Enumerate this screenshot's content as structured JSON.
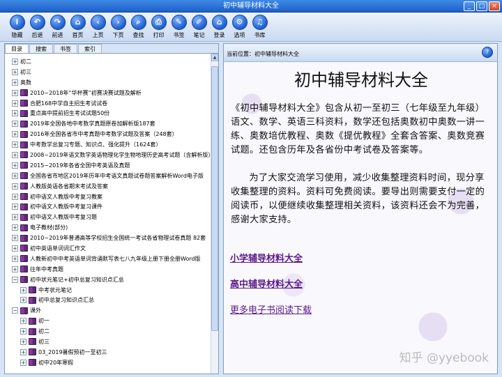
{
  "window": {
    "title": "初中辅导材料大全"
  },
  "toolbar": {
    "buttons": [
      {
        "label": "隐藏",
        "icon": "i"
      },
      {
        "label": "后退",
        "icon": "↶"
      },
      {
        "label": "前进",
        "icon": "↷"
      },
      {
        "label": "首页",
        "icon": "⌂"
      },
      {
        "label": "上页",
        "icon": "‹"
      },
      {
        "label": "下页",
        "icon": "›"
      },
      {
        "label": "查找",
        "icon": "⌕"
      },
      {
        "label": "打印",
        "icon": "⎙"
      },
      {
        "label": "书签",
        "icon": "✎"
      },
      {
        "label": "笔记",
        "icon": "✐"
      },
      {
        "label": "登录",
        "icon": "⌂"
      },
      {
        "label": "选项",
        "icon": "⚙"
      },
      {
        "label": "书库",
        "icon": "♫"
      }
    ]
  },
  "left": {
    "tabs": [
      "目录",
      "搜索",
      "书签",
      "索引"
    ],
    "tree": [
      {
        "label": "初二",
        "exp": "⊞",
        "book": false,
        "indent": 0
      },
      {
        "label": "初三",
        "exp": "⊞",
        "book": false,
        "indent": 0
      },
      {
        "label": "奥数",
        "exp": "⊞",
        "book": false,
        "indent": 0
      },
      {
        "label": "2010~2018年“华杯赛”初赛决赛试题及解析",
        "exp": "⊞",
        "book": true,
        "indent": 0
      },
      {
        "label": "合肥168中学自主招生考试试卷",
        "exp": "⊞",
        "book": true,
        "indent": 0
      },
      {
        "label": "重点高中提前招生考试试题50份",
        "exp": "⊞",
        "book": true,
        "indent": 0
      },
      {
        "label": "2019年全国各地中考数学真题原卷加解析版187套",
        "exp": "⊞",
        "book": true,
        "indent": 0
      },
      {
        "label": "2016年全国各省市中考真题中考数学试题及答案（248套）",
        "exp": "⊞",
        "book": true,
        "indent": 0
      },
      {
        "label": "中考数学总复习专题、知识点、强化提升（1624套）",
        "exp": "⊞",
        "book": true,
        "indent": 0
      },
      {
        "label": "2008~2019年语文数学英语物理化学生物地理历史高考试题（含解析版）",
        "exp": "⊞",
        "book": true,
        "indent": 0
      },
      {
        "label": "2015~2019年各省全国中考英语及真题",
        "exp": "⊞",
        "book": true,
        "indent": 0
      },
      {
        "label": "全国各省市地区2019年历年中考语文真题试卷题答案解析Word电子版",
        "exp": "⊞",
        "book": true,
        "indent": 0
      },
      {
        "label": "人教版英语各省期末考试及答案",
        "exp": "⊞",
        "book": true,
        "indent": 0
      },
      {
        "label": "初中语文人教版中考复习教案",
        "exp": "⊞",
        "book": true,
        "indent": 0
      },
      {
        "label": "初中语文人教版中考复习课件",
        "exp": "⊞",
        "book": true,
        "indent": 0
      },
      {
        "label": "初中语文人教版中考复习题",
        "exp": "⊞",
        "book": true,
        "indent": 0
      },
      {
        "label": "电子教材(部分)",
        "exp": "⊞",
        "book": true,
        "indent": 0
      },
      {
        "label": "2010~2019年普通高等学校招生全国统一考试各省物理试卷真题 82套",
        "exp": "⊞",
        "book": true,
        "indent": 0
      },
      {
        "label": "初中英语单词词汇作文",
        "exp": "⊞",
        "book": true,
        "indent": 0
      },
      {
        "label": "人教新初中中考英语单词背诵默写表七八九年级上册下册全册Word版",
        "exp": "⊞",
        "book": true,
        "indent": 0
      },
      {
        "label": "往年中考真题",
        "exp": "⊞",
        "book": true,
        "indent": 0
      },
      {
        "label": "初中状元笔记+初中总复习知识点汇总",
        "exp": "⊟",
        "book": true,
        "indent": 0
      },
      {
        "label": "中考状元笔记",
        "exp": "⊞",
        "book": true,
        "indent": 1
      },
      {
        "label": "初中总复习知识点汇总",
        "exp": "⊞",
        "book": true,
        "indent": 1
      },
      {
        "label": "课外",
        "exp": "⊟",
        "book": true,
        "indent": 0
      },
      {
        "label": "初一",
        "exp": "⊞",
        "book": true,
        "indent": 1
      },
      {
        "label": "初二",
        "exp": "⊞",
        "book": true,
        "indent": 1
      },
      {
        "label": "初三",
        "exp": "⊞",
        "book": true,
        "indent": 1
      },
      {
        "label": "03_2019暑假预初一至初三",
        "exp": "⊞",
        "book": true,
        "indent": 1
      },
      {
        "label": "初中20年寒假",
        "exp": "⊞",
        "book": true,
        "indent": 1
      }
    ]
  },
  "right": {
    "location_label": "当前位置：",
    "location_value": "初中辅导材料大全",
    "title": "初中辅导材料大全",
    "paragraph1": "《初中辅导材料大全》包含从初一至初三（七年级至九年级）语文、数学、英语三科资料，数学还包括奥数初中奥数一讲一练、奥数培优教程、奥数《提优教程》全套含答案、奥数竞赛试题。还包含历年及各省份中考试卷及答案等。",
    "paragraph2": "为了大家交流学习使用，减少收集整理资料时间，现分享收集整理的资料。资料可免费阅读。要导出则需要支付一定的阅读币，以便继续收集整理相关资料，该资料还会不为完善，感谢大家支持。",
    "link1": "小学辅导材料大全",
    "link2": "高中辅导材料大全",
    "link3": "更多电子书阅读下载",
    "watermark": "知乎 @yyebook"
  }
}
